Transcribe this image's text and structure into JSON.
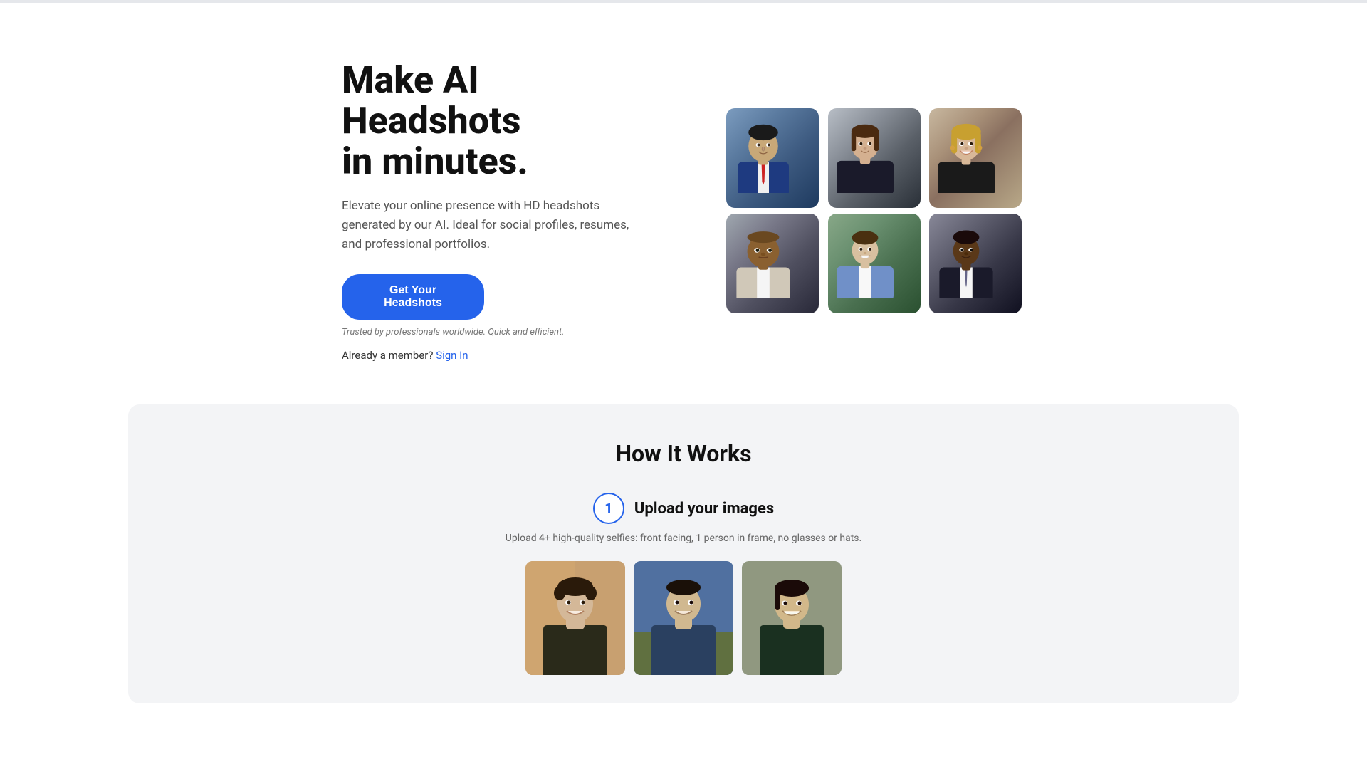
{
  "top_border": {},
  "hero": {
    "title_line1": "Make AI Headshots",
    "title_line2": "in minutes.",
    "subtitle": "Elevate your online presence with HD headshots generated by our AI. Ideal for social profiles, resumes, and professional portfolios.",
    "cta_button_label": "Get Your Headshots",
    "trusted_text": "Trusted by professionals worldwide. Quick and efficient.",
    "member_text": "Already a member?",
    "sign_in_label": "Sign In"
  },
  "headshots": {
    "images": [
      {
        "id": 1,
        "alt": "Professional male headshot with suit and red tie"
      },
      {
        "id": 2,
        "alt": "Professional female headshot with dark blazer"
      },
      {
        "id": 3,
        "alt": "Woman with blonde hair smiling"
      },
      {
        "id": 4,
        "alt": "Bald man with confident look"
      },
      {
        "id": 5,
        "alt": "Young man in light blue suit outdoors"
      },
      {
        "id": 6,
        "alt": "Black man in dark suit with tie"
      }
    ]
  },
  "how_it_works": {
    "section_title": "How It Works",
    "step1": {
      "number": "1",
      "title": "Upload your images",
      "description": "Upload 4+ high-quality selfies: front facing, 1 person in frame, no glasses or hats.",
      "sample_images": [
        {
          "id": 1,
          "alt": "Casual selfie of young man indoors"
        },
        {
          "id": 2,
          "alt": "Selfie of young man outdoors"
        },
        {
          "id": 3,
          "alt": "Selfie of young man smiling"
        }
      ]
    }
  },
  "colors": {
    "accent_blue": "#2563eb",
    "background_section": "#f3f4f6",
    "text_primary": "#111111",
    "text_secondary": "#555555",
    "text_muted": "#777777"
  }
}
